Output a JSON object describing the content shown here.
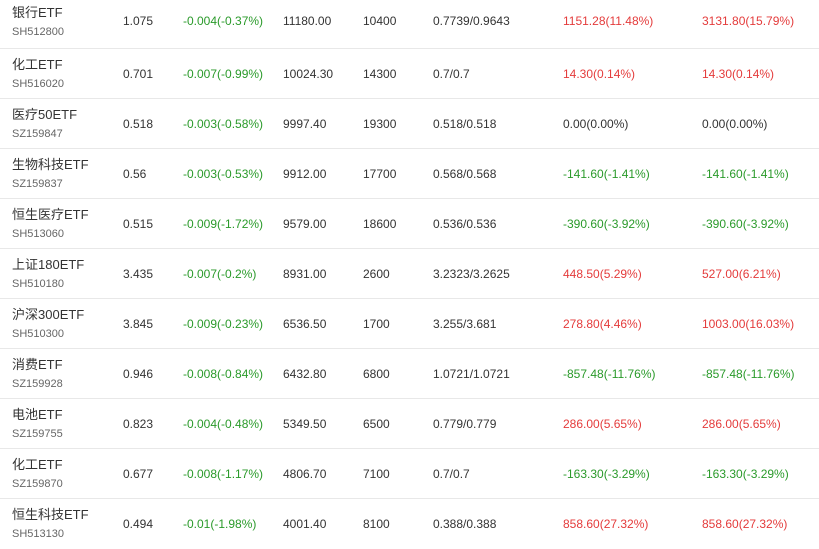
{
  "colors": {
    "up": "#e43b3b",
    "down": "#2a9a2a",
    "flat": "#333333"
  },
  "rows": [
    {
      "name": "银行ETF",
      "code": "SH512800",
      "price": "1.075",
      "change": "-0.004(-0.37%)",
      "market_value": "11180.00",
      "quantity": "10400",
      "cost": "0.7739/0.9643",
      "pl_1": "1151.28(11.48%)",
      "pl_1_dir": "red",
      "pl_2": "3131.80(15.79%)",
      "pl_2_dir": "red"
    },
    {
      "name": "化工ETF",
      "code": "SH516020",
      "price": "0.701",
      "change": "-0.007(-0.99%)",
      "market_value": "10024.30",
      "quantity": "14300",
      "cost": "0.7/0.7",
      "pl_1": "14.30(0.14%)",
      "pl_1_dir": "red",
      "pl_2": "14.30(0.14%)",
      "pl_2_dir": "red"
    },
    {
      "name": "医疗50ETF",
      "code": "SZ159847",
      "price": "0.518",
      "change": "-0.003(-0.58%)",
      "market_value": "9997.40",
      "quantity": "19300",
      "cost": "0.518/0.518",
      "pl_1": "0.00(0.00%)",
      "pl_1_dir": "neutral",
      "pl_2": "0.00(0.00%)",
      "pl_2_dir": "neutral"
    },
    {
      "name": "生物科技ETF",
      "code": "SZ159837",
      "price": "0.56",
      "change": "-0.003(-0.53%)",
      "market_value": "9912.00",
      "quantity": "17700",
      "cost": "0.568/0.568",
      "pl_1": "-141.60(-1.41%)",
      "pl_1_dir": "green",
      "pl_2": "-141.60(-1.41%)",
      "pl_2_dir": "green"
    },
    {
      "name": "恒生医疗ETF",
      "code": "SH513060",
      "price": "0.515",
      "change": "-0.009(-1.72%)",
      "market_value": "9579.00",
      "quantity": "18600",
      "cost": "0.536/0.536",
      "pl_1": "-390.60(-3.92%)",
      "pl_1_dir": "green",
      "pl_2": "-390.60(-3.92%)",
      "pl_2_dir": "green"
    },
    {
      "name": "上证180ETF",
      "code": "SH510180",
      "price": "3.435",
      "change": "-0.007(-0.2%)",
      "market_value": "8931.00",
      "quantity": "2600",
      "cost": "3.2323/3.2625",
      "pl_1": "448.50(5.29%)",
      "pl_1_dir": "red",
      "pl_2": "527.00(6.21%)",
      "pl_2_dir": "red"
    },
    {
      "name": "沪深300ETF",
      "code": "SH510300",
      "price": "3.845",
      "change": "-0.009(-0.23%)",
      "market_value": "6536.50",
      "quantity": "1700",
      "cost": "3.255/3.681",
      "pl_1": "278.80(4.46%)",
      "pl_1_dir": "red",
      "pl_2": "1003.00(16.03%)",
      "pl_2_dir": "red"
    },
    {
      "name": "消费ETF",
      "code": "SZ159928",
      "price": "0.946",
      "change": "-0.008(-0.84%)",
      "market_value": "6432.80",
      "quantity": "6800",
      "cost": "1.0721/1.0721",
      "pl_1": "-857.48(-11.76%)",
      "pl_1_dir": "green",
      "pl_2": "-857.48(-11.76%)",
      "pl_2_dir": "green"
    },
    {
      "name": "电池ETF",
      "code": "SZ159755",
      "price": "0.823",
      "change": "-0.004(-0.48%)",
      "market_value": "5349.50",
      "quantity": "6500",
      "cost": "0.779/0.779",
      "pl_1": "286.00(5.65%)",
      "pl_1_dir": "red",
      "pl_2": "286.00(5.65%)",
      "pl_2_dir": "red"
    },
    {
      "name": "化工ETF",
      "code": "SZ159870",
      "price": "0.677",
      "change": "-0.008(-1.17%)",
      "market_value": "4806.70",
      "quantity": "7100",
      "cost": "0.7/0.7",
      "pl_1": "-163.30(-3.29%)",
      "pl_1_dir": "green",
      "pl_2": "-163.30(-3.29%)",
      "pl_2_dir": "green"
    },
    {
      "name": "恒生科技ETF",
      "code": "SH513130",
      "price": "0.494",
      "change": "-0.01(-1.98%)",
      "market_value": "4001.40",
      "quantity": "8100",
      "cost": "0.388/0.388",
      "pl_1": "858.60(27.32%)",
      "pl_1_dir": "red",
      "pl_2": "858.60(27.32%)",
      "pl_2_dir": "red"
    }
  ]
}
